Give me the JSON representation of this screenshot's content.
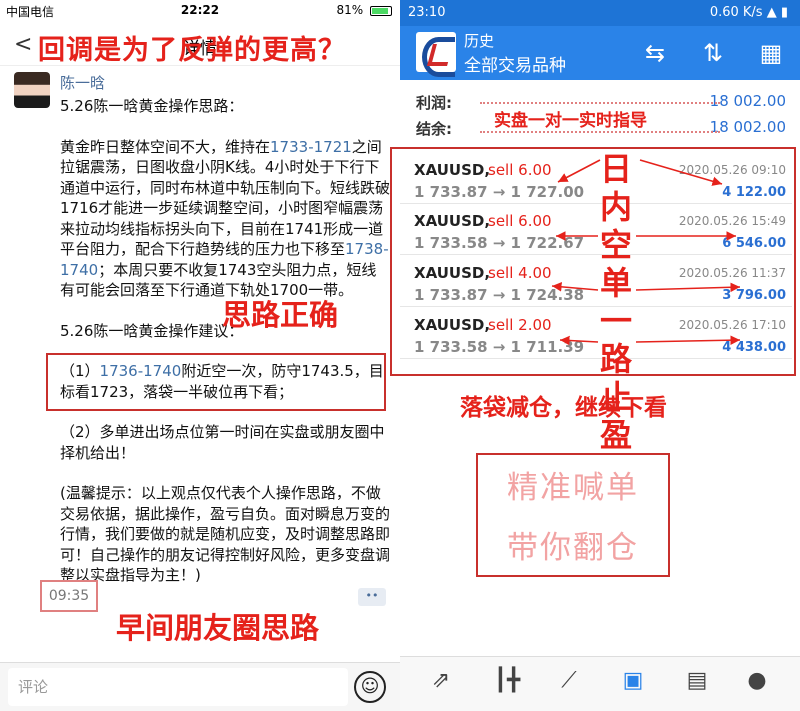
{
  "left": {
    "status": {
      "carrier": "中国电信",
      "time": "22:22",
      "battery": "81%"
    },
    "nav": {
      "back": "<",
      "title": "详情"
    },
    "overlay_title": "回调是为了反弹的更高？",
    "author": "陈一晗",
    "post": {
      "heading": "5.26陈一晗黄金操作思路：",
      "para1_a": "黄金昨日整体空间不大，维持在",
      "para1_hl": "1733-1721",
      "para1_b": "之间拉锯震荡，日图收盘小阴K线。4小时处于下行下通道中运行，同时布林道中轨压制向下。短线跌破1716才能进一步延续调整空间，小时图窄幅震荡来拉动均线指标拐头向下，目前在1741形成一道平台阻力，配合下行趋势线的压力也下移至",
      "para1_hl2": "1738-1740",
      "para1_c": "；本周只要不收复1743空头阻力点，短线有可能会回落至下行通道下轨处1700一带。",
      "heading2": "5.26陈一晗黄金操作建议：",
      "sugg1_a": "（1）",
      "sugg1_hl": "1736-1740",
      "sugg1_b": "附近空一次，防守1743.5，目标看1723，落袋一半破位再下看；",
      "sugg2": "（2）多单进出场点位第一时间在实盘或朋友圈中择机给出！",
      "tip": "(温馨提示：以上观点仅代表个人操作思路，不做交易依据，据此操作，盈亏自负。面对瞬息万变的行情，我们要做的就是随机应变，及时调整思路即可！自己操作的朋友记得控制好风险，更多变盘调整以实盘指导为主！)"
    },
    "overlay_mid": "思路正确",
    "time": "09:35",
    "dots": "••",
    "overlay_bottom": "早间朋友圈思路",
    "comment_placeholder": "评论"
  },
  "right": {
    "status": {
      "time": "23:10",
      "speed": "0.60 K/s"
    },
    "header": {
      "line1": "历史",
      "line2": "全部交易品种"
    },
    "summary": [
      {
        "label": "利润:",
        "value": "18 002.00"
      },
      {
        "label": "结余:",
        "value": "18 002.00"
      }
    ],
    "overlay_r1": "实盘一对一实时指导",
    "trades": [
      {
        "symbol": "XAUUSD,",
        "side": "sell 6.00",
        "date": "2020.05.26 09:10",
        "prices": "1 733.87 → 1 727.00",
        "profit": "4 122.00"
      },
      {
        "symbol": "XAUUSD,",
        "side": "sell 6.00",
        "date": "2020.05.26 15:49",
        "prices": "1 733.58 → 1 722.67",
        "profit": "6 546.00"
      },
      {
        "symbol": "XAUUSD,",
        "side": "sell 4.00",
        "date": "2020.05.26 11:37",
        "prices": "1 733.87 → 1 724.38",
        "profit": "3 796.00"
      },
      {
        "symbol": "XAUUSD,",
        "side": "sell 2.00",
        "date": "2020.05.26 17:10",
        "prices": "1 733.58 → 1 711.39",
        "profit": "4 438.00"
      }
    ],
    "vertical_text": [
      "日",
      "内",
      "空",
      "单",
      "一",
      "路",
      "止",
      "盈"
    ],
    "overlay_r2": "落袋减仓，继续下看",
    "pink1": "精准喊单",
    "pink2": "带你翻仓",
    "colors": {
      "header_blue": "#2a83e8",
      "overlay_red": "#e5221b",
      "profit_blue": "#2a6fd2"
    }
  }
}
